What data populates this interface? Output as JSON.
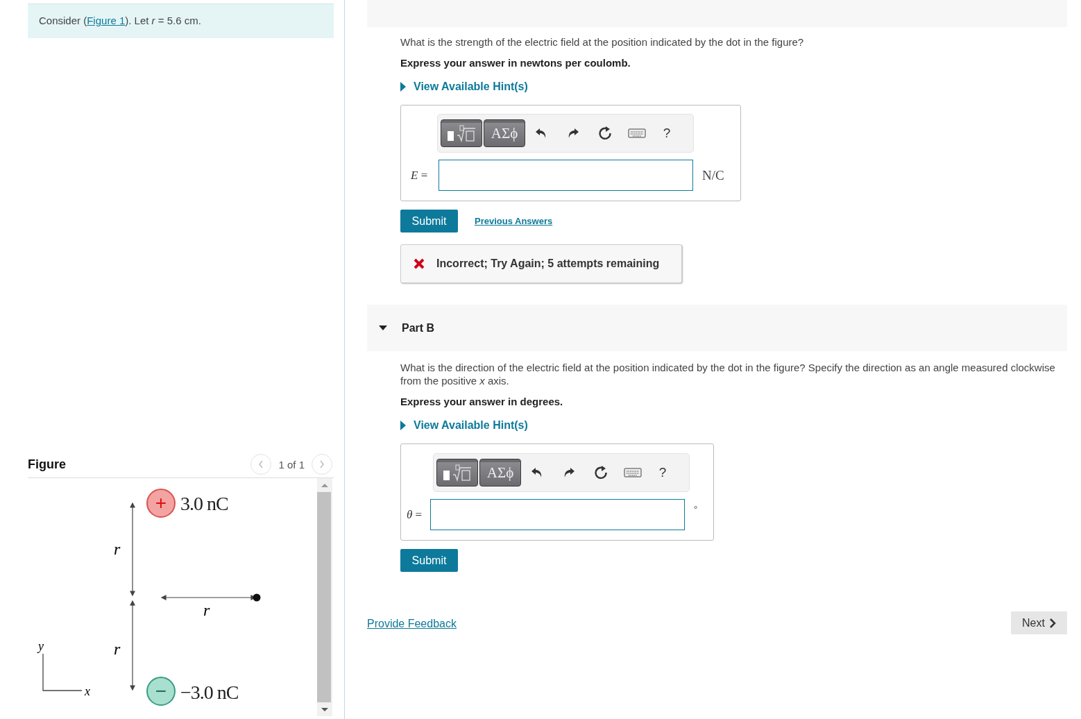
{
  "intro": {
    "before": "Consider (",
    "link": "Figure 1",
    "after": "). Let *r* = 5.6 cm."
  },
  "figure": {
    "title": "Figure",
    "pager": "1 of 1",
    "charges": [
      {
        "sign": "+",
        "label": "3.0 nC",
        "color": "#f4a3a3"
      },
      {
        "sign": "−",
        "label": "−3.0 nC",
        "color": "#a8dfcf"
      }
    ],
    "distance_labels": [
      "r",
      "r",
      "r"
    ],
    "axis_labels": [
      "y",
      "x"
    ]
  },
  "parts": [
    {
      "question": "What is the strength of the electric field at the position indicated by the dot in the figure?",
      "instruction": "Express your answer in newtons per coulomb.",
      "hint": "View Available Hint(s)",
      "symbols": "ΑΣϕ",
      "help": "?",
      "variable": "*E* =",
      "unit": "N/C",
      "submit": "Submit",
      "previous_answers": "Previous Answers",
      "feedback": "Incorrect; Try Again; 5 attempts remaining"
    },
    {
      "title": "Part B",
      "expanded": true,
      "question": "What is the direction of the electric field at the position indicated by the dot in the figure? Specify the direction as an angle measured clockwise from the positive *x* axis.",
      "instruction": "Express your answer in degrees.",
      "hint": "View Available Hint(s)",
      "symbols": "ΑΣϕ",
      "help": "?",
      "variable": "*θ* =",
      "unit": "°",
      "submit": "Submit"
    }
  ],
  "footer": {
    "feedback_link": "Provide Feedback",
    "next": "Next"
  }
}
